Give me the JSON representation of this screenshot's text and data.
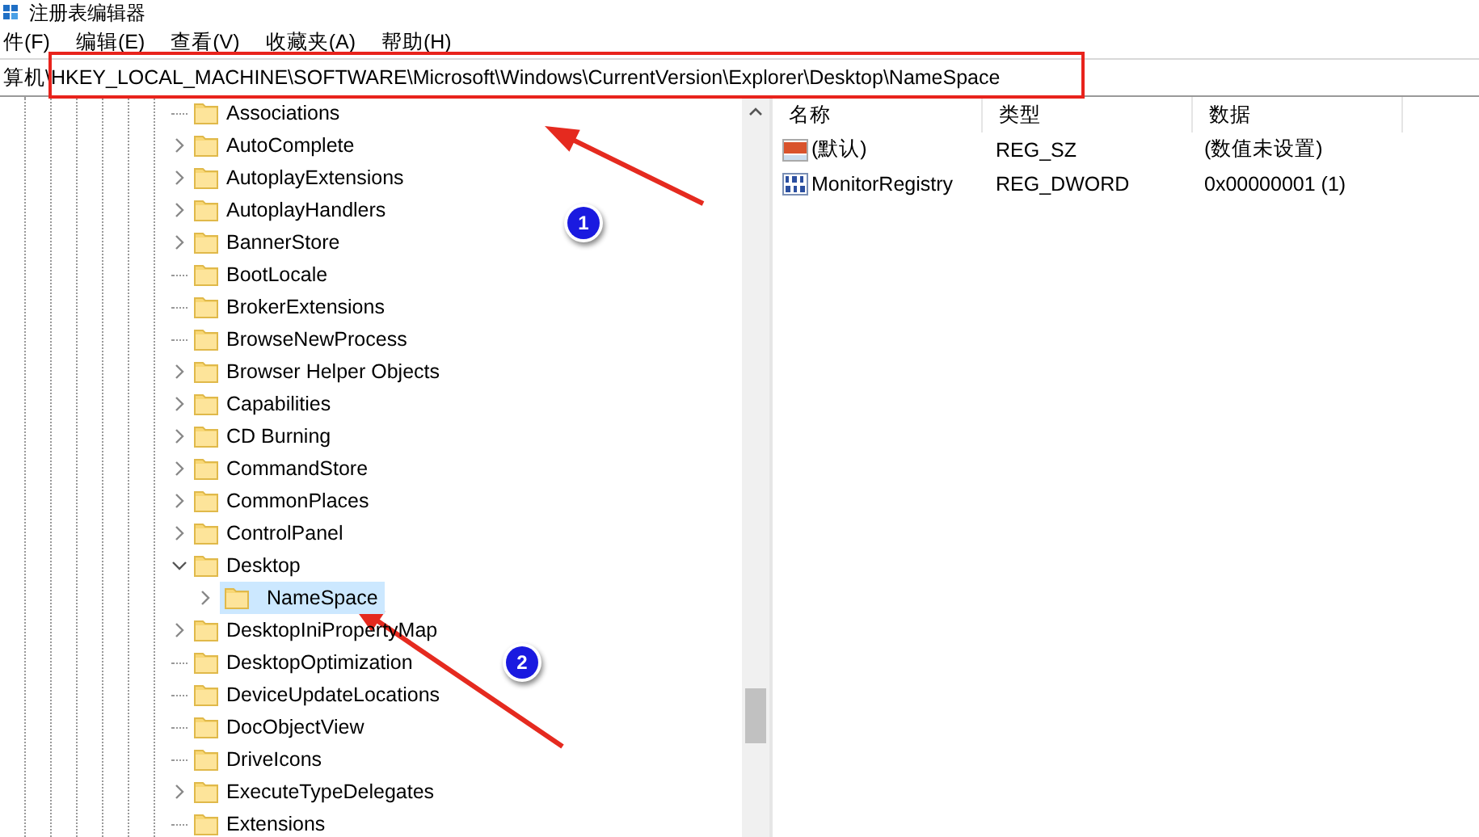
{
  "window": {
    "title": "注册表编辑器"
  },
  "menu": [
    "件(F)",
    "编辑(E)",
    "查看(V)",
    "收藏夹(A)",
    "帮助(H)"
  ],
  "address": "算机\\HKEY_LOCAL_MACHINE\\SOFTWARE\\Microsoft\\Windows\\CurrentVersion\\Explorer\\Desktop\\NameSpace",
  "tree": [
    {
      "label": "Associations",
      "expandable": false,
      "selected": false
    },
    {
      "label": "AutoComplete",
      "expandable": true,
      "selected": false
    },
    {
      "label": "AutoplayExtensions",
      "expandable": true,
      "selected": false
    },
    {
      "label": "AutoplayHandlers",
      "expandable": true,
      "selected": false
    },
    {
      "label": "BannerStore",
      "expandable": true,
      "selected": false
    },
    {
      "label": "BootLocale",
      "expandable": false,
      "selected": false
    },
    {
      "label": "BrokerExtensions",
      "expandable": false,
      "selected": false
    },
    {
      "label": "BrowseNewProcess",
      "expandable": false,
      "selected": false
    },
    {
      "label": "Browser Helper Objects",
      "expandable": true,
      "selected": false
    },
    {
      "label": "Capabilities",
      "expandable": true,
      "selected": false
    },
    {
      "label": "CD Burning",
      "expandable": true,
      "selected": false
    },
    {
      "label": "CommandStore",
      "expandable": true,
      "selected": false
    },
    {
      "label": "CommonPlaces",
      "expandable": true,
      "selected": false
    },
    {
      "label": "ControlPanel",
      "expandable": true,
      "selected": false
    },
    {
      "label": "Desktop",
      "expandable": true,
      "expanded": true,
      "selected": false,
      "children": [
        {
          "label": "NameSpace",
          "expandable": true,
          "selected": true
        }
      ]
    },
    {
      "label": "DesktopIniPropertyMap",
      "expandable": true,
      "selected": false
    },
    {
      "label": "DesktopOptimization",
      "expandable": false,
      "selected": false
    },
    {
      "label": "DeviceUpdateLocations",
      "expandable": false,
      "selected": false
    },
    {
      "label": "DocObjectView",
      "expandable": false,
      "selected": false
    },
    {
      "label": "DriveIcons",
      "expandable": false,
      "selected": false
    },
    {
      "label": "ExecuteTypeDelegates",
      "expandable": true,
      "selected": false
    },
    {
      "label": "Extensions",
      "expandable": false,
      "selected": false
    }
  ],
  "table": {
    "columns": [
      "名称",
      "类型",
      "数据"
    ],
    "rows": [
      {
        "kind": "string",
        "name": "(默认)",
        "type": "REG_SZ",
        "data": "(数值未设置)"
      },
      {
        "kind": "binary",
        "name": "MonitorRegistry",
        "type": "REG_DWORD",
        "data": "0x00000001 (1)"
      }
    ]
  },
  "annotations": [
    {
      "kind": "arrow",
      "badge": "1"
    },
    {
      "kind": "arrow",
      "badge": "2"
    }
  ]
}
